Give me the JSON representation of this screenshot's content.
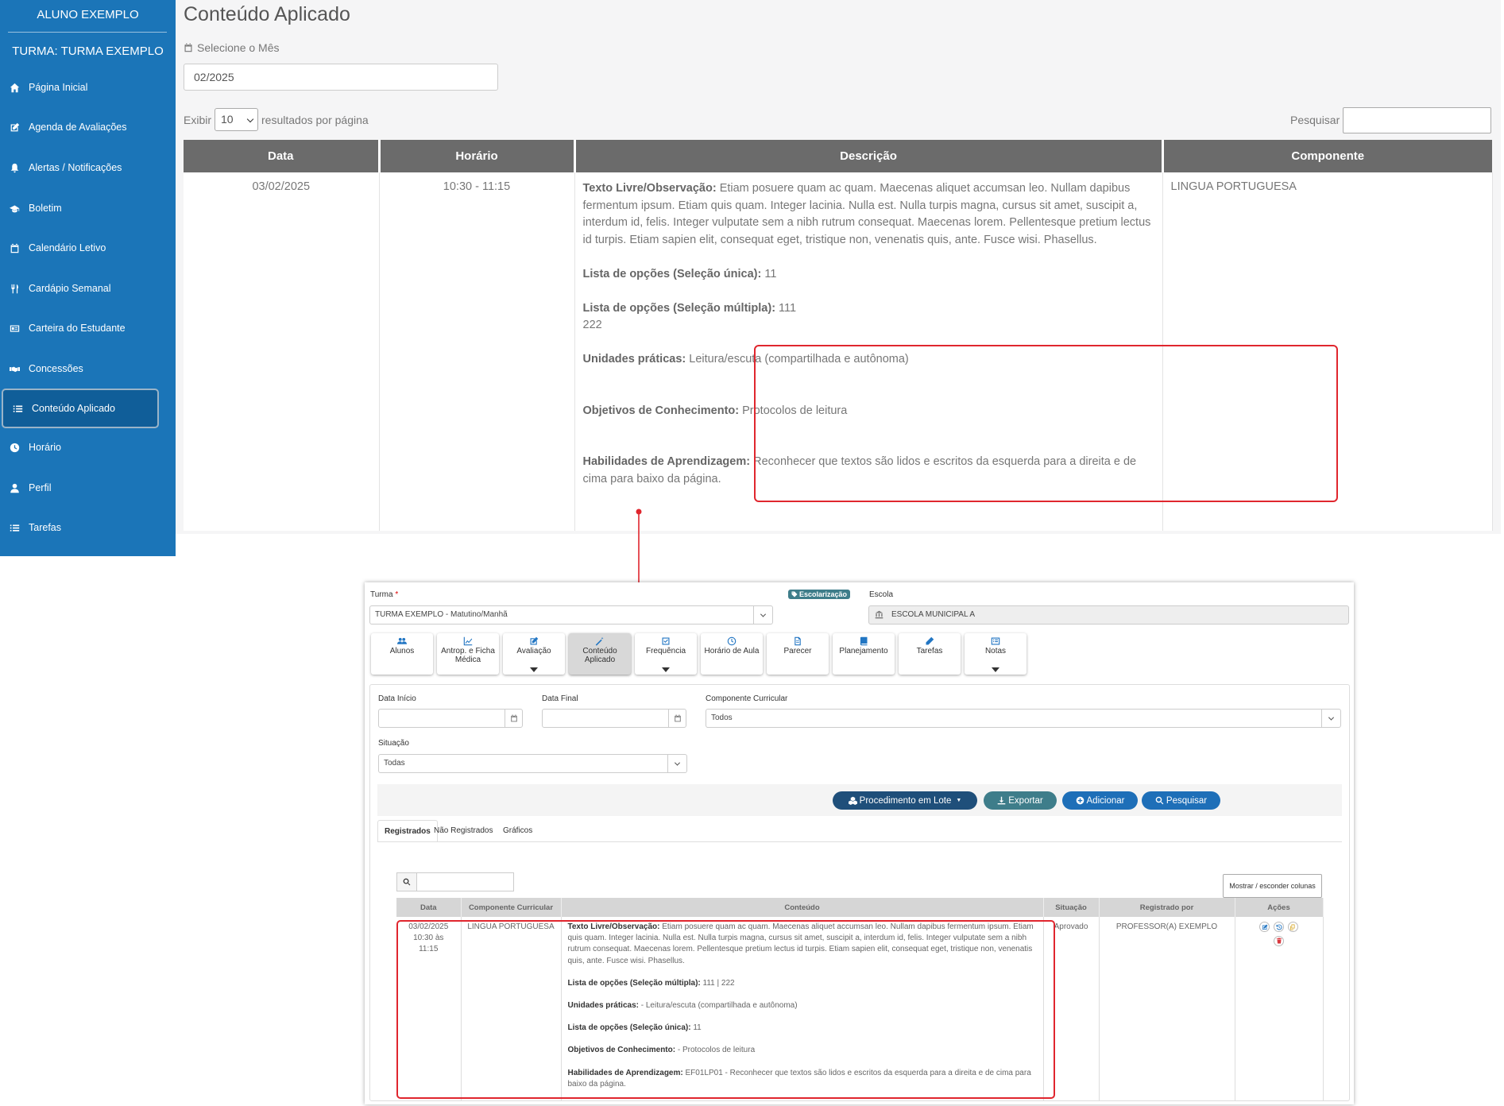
{
  "student": {
    "name": "ALUNO EXEMPLO",
    "class": "TURMA: TURMA EXEMPLO"
  },
  "sidebar": {
    "items": [
      {
        "label": "Página Inicial",
        "icon": "home-icon"
      },
      {
        "label": "Agenda de Avaliações",
        "icon": "edit-icon"
      },
      {
        "label": "Alertas / Notificações",
        "icon": "bell-icon"
      },
      {
        "label": "Boletim",
        "icon": "graduation-cap-icon"
      },
      {
        "label": "Calendário Letivo",
        "icon": "calendar-icon"
      },
      {
        "label": "Cardápio Semanal",
        "icon": "cutlery-icon"
      },
      {
        "label": "Carteira do Estudante",
        "icon": "id-card-icon"
      },
      {
        "label": "Concessões",
        "icon": "handshake-icon"
      },
      {
        "label": "Conteúdo Aplicado",
        "icon": "list-icon",
        "active": true
      },
      {
        "label": "Horário",
        "icon": "clock-icon"
      },
      {
        "label": "Perfil",
        "icon": "user-icon"
      },
      {
        "label": "Tarefas",
        "icon": "list-icon"
      }
    ]
  },
  "portal": {
    "title": "Conteúdo Aplicado",
    "month_label": "Selecione o Mês",
    "month_value": "02/2025",
    "length_prefix": "Exibir",
    "length_value": "10",
    "length_suffix": "resultados por página",
    "search_label": "Pesquisar",
    "columns": [
      "Data",
      "Horário",
      "Descrição",
      "Componente"
    ],
    "row": {
      "date": "03/02/2025",
      "time": "10:30 - 11:15",
      "component": "LINGUA PORTUGUESA",
      "desc": {
        "free_label": "Texto Livre/Observação:",
        "free_text": " Etiam posuere quam ac quam. Maecenas aliquet accumsan leo. Nullam dapibus fermentum ipsum. Etiam quis quam. Integer lacinia. Nulla est. Nulla turpis magna, cursus sit amet, suscipit a, interdum id, felis. Integer vulputate sem a nibh rutrum consequat. Maecenas lorem. Pellentesque pretium lectus id turpis. Etiam sapien elit, consequat eget, tristique non, venenatis quis, ante. Fusce wisi. Phasellus.",
        "single_label": "Lista de opções (Seleção única):",
        "single_value": " 11",
        "multi_label": "Lista de opções (Seleção múltipla):",
        "multi_value_1": " 111",
        "multi_value_2": "222",
        "units_label": "Unidades práticas:",
        "units_value": " Leitura/escuta (compartilhada e autônoma)",
        "objectives_label": "Objetivos de Conhecimento:",
        "objectives_value": " Protocolos de leitura",
        "skills_label": "Habilidades de Aprendizagem:",
        "skills_value": " Reconhecer que textos são lidos e escritos da esquerda para a direita e de cima para baixo da página."
      }
    }
  },
  "admin": {
    "turma_label": "Turma",
    "turma_required": "*",
    "turma_value": "TURMA EXEMPLO - Matutino/Manhã",
    "badge": "Escolarização",
    "escola_label": "Escola",
    "escola_value": "ESCOLA MUNICIPAL A",
    "toolbar": [
      {
        "label": "Alunos",
        "icon": "users-icon"
      },
      {
        "label": "Antrop. e Ficha Médica",
        "icon": "chart-line-icon"
      },
      {
        "label": "Avaliação",
        "icon": "edit-icon",
        "dropdown": true
      },
      {
        "label": "Conteúdo Aplicado",
        "icon": "pencil-icon",
        "active": true
      },
      {
        "label": "Frequência",
        "icon": "check-square-icon",
        "dropdown": true
      },
      {
        "label": "Horário de Aula",
        "icon": "clock-icon"
      },
      {
        "label": "Parecer",
        "icon": "file-icon"
      },
      {
        "label": "Planejamento",
        "icon": "book-icon"
      },
      {
        "label": "Tarefas",
        "icon": "pencil-icon"
      },
      {
        "label": "Notas",
        "icon": "list-alt-icon",
        "dropdown": true
      }
    ],
    "filters": {
      "start_label": "Data Início",
      "end_label": "Data Final",
      "component_label": "Componente Curricular",
      "component_value": "Todos",
      "status_label": "Situação",
      "status_value": "Todas"
    },
    "actions": {
      "batch": "Procedimento em Lote",
      "export": "Exportar",
      "add": "Adicionar",
      "search": "Pesquisar"
    },
    "tabs": [
      "Registrados",
      "Não Registrados",
      "Gráficos"
    ],
    "toggle_columns": "Mostrar / esconder colunas",
    "columns": [
      "Data",
      "Componente Curricular",
      "Conteúdo",
      "Situação",
      "Registrado por",
      "Ações"
    ],
    "row": {
      "date": "03/02/2025",
      "time_line": "10:30 às",
      "time_end": "11:15",
      "component": "LINGUA PORTUGUESA",
      "status": "Aprovado",
      "registered_by": "PROFESSOR(A) EXEMPLO",
      "content": {
        "free_label": "Texto Livre/Observação:",
        "free_text": " Etiam posuere quam ac quam. Maecenas aliquet accumsan leo. Nullam dapibus fermentum ipsum. Etiam quis quam. Integer lacinia. Nulla est. Nulla turpis magna, cursus sit amet, suscipit a, interdum id, felis. Integer vulputate sem a nibh rutrum consequat. Maecenas lorem. Pellentesque pretium lectus id turpis. Etiam sapien elit, consequat eget, tristique non, venenatis quis, ante. Fusce wisi. Phasellus.",
        "multi_label": "Lista de opções (Seleção múltipla):",
        "multi_value": " 111 | 222",
        "units_label": "Unidades práticas:",
        "units_value": "  - Leitura/escuta (compartilhada e autônoma)",
        "single_label": "Lista de opções (Seleção única):",
        "single_value": " 11",
        "objectives_label": "Objetivos de Conhecimento:",
        "objectives_value": "  - Protocolos de leitura",
        "skills_label": "Habilidades de Aprendizagem:",
        "skills_value": " EF01LP01 - Reconhecer que textos são lidos e escritos da esquerda para a direita e de cima para baixo da página."
      }
    }
  },
  "colors": {
    "sidebar": "#1b75b8",
    "table_header": "#6b6b6b",
    "highlight": "#e0262e",
    "batch_btn": "#1f4f7a",
    "export_btn": "#3e7d8a",
    "primary_btn": "#1e6fb8"
  }
}
